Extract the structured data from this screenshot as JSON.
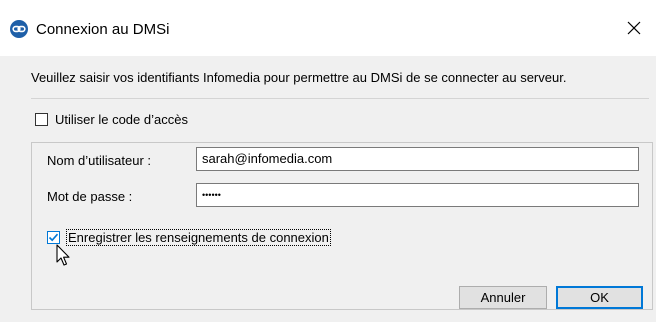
{
  "window": {
    "title": "Connexion au DMSi",
    "app_icon": "infomedia-link-icon",
    "close_icon": "close-icon"
  },
  "dialog": {
    "instructions": "Veuillez saisir vos identifiants Infomedia pour permettre au DMSi de se connecter au serveur.",
    "access_code_checkbox": {
      "label": "Utiliser le code d’accès",
      "checked": false
    },
    "username": {
      "label": "Nom d’utilisateur :",
      "value": "sarah@infomedia.com"
    },
    "password": {
      "label": "Mot de passe :",
      "value": "••••••"
    },
    "remember_checkbox": {
      "label": "Enregistrer les renseignements de connexion",
      "checked": true
    }
  },
  "buttons": {
    "cancel": "Annuler",
    "ok": "OK"
  },
  "colors": {
    "accent": "#0078d7",
    "icon_blue": "#1e5fa8",
    "background": "#f0f0f0"
  }
}
